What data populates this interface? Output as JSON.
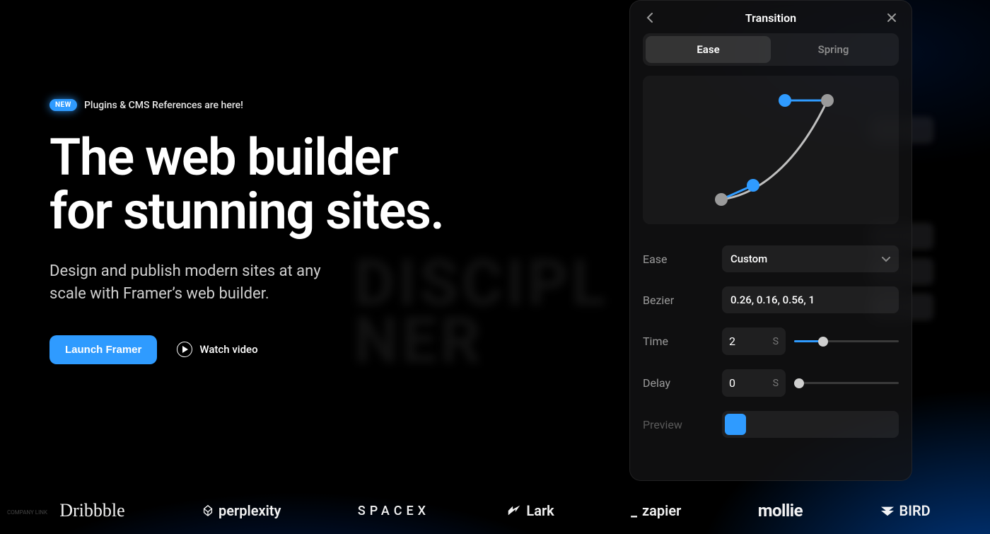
{
  "hero": {
    "badge": "NEW",
    "announcement": "Plugins & CMS References are here!",
    "headline_line1": "The web builder",
    "headline_line2": "for stunning sites.",
    "subhead": "Design and publish modern sites at any scale with Framer’s web builder.",
    "primary_cta": "Launch Framer",
    "secondary_cta": "Watch video"
  },
  "background_text": {
    "line1": "DISCIPL",
    "line2": "NER"
  },
  "panel": {
    "title": "Transition",
    "tabs": {
      "ease": "Ease",
      "spring": "Spring",
      "active": "ease"
    },
    "fields": {
      "ease": {
        "label": "Ease",
        "value": "Custom"
      },
      "bezier": {
        "label": "Bezier",
        "value": "0.26, 0.16, 0.56, 1"
      },
      "time": {
        "label": "Time",
        "value": "2",
        "unit": "S",
        "slider": 0.28
      },
      "delay": {
        "label": "Delay",
        "value": "0",
        "unit": "S",
        "slider": 0.05
      },
      "preview": {
        "label": "Preview"
      }
    }
  },
  "logos": {
    "dribbble": "Dribbble",
    "perplexity": "perplexity",
    "spacex": "SPACEX",
    "lark": "Lark",
    "zapier": "zapier",
    "mollie": "mollie",
    "bird": "BIRD"
  },
  "corner_tag": "COMPANY\nLINK"
}
